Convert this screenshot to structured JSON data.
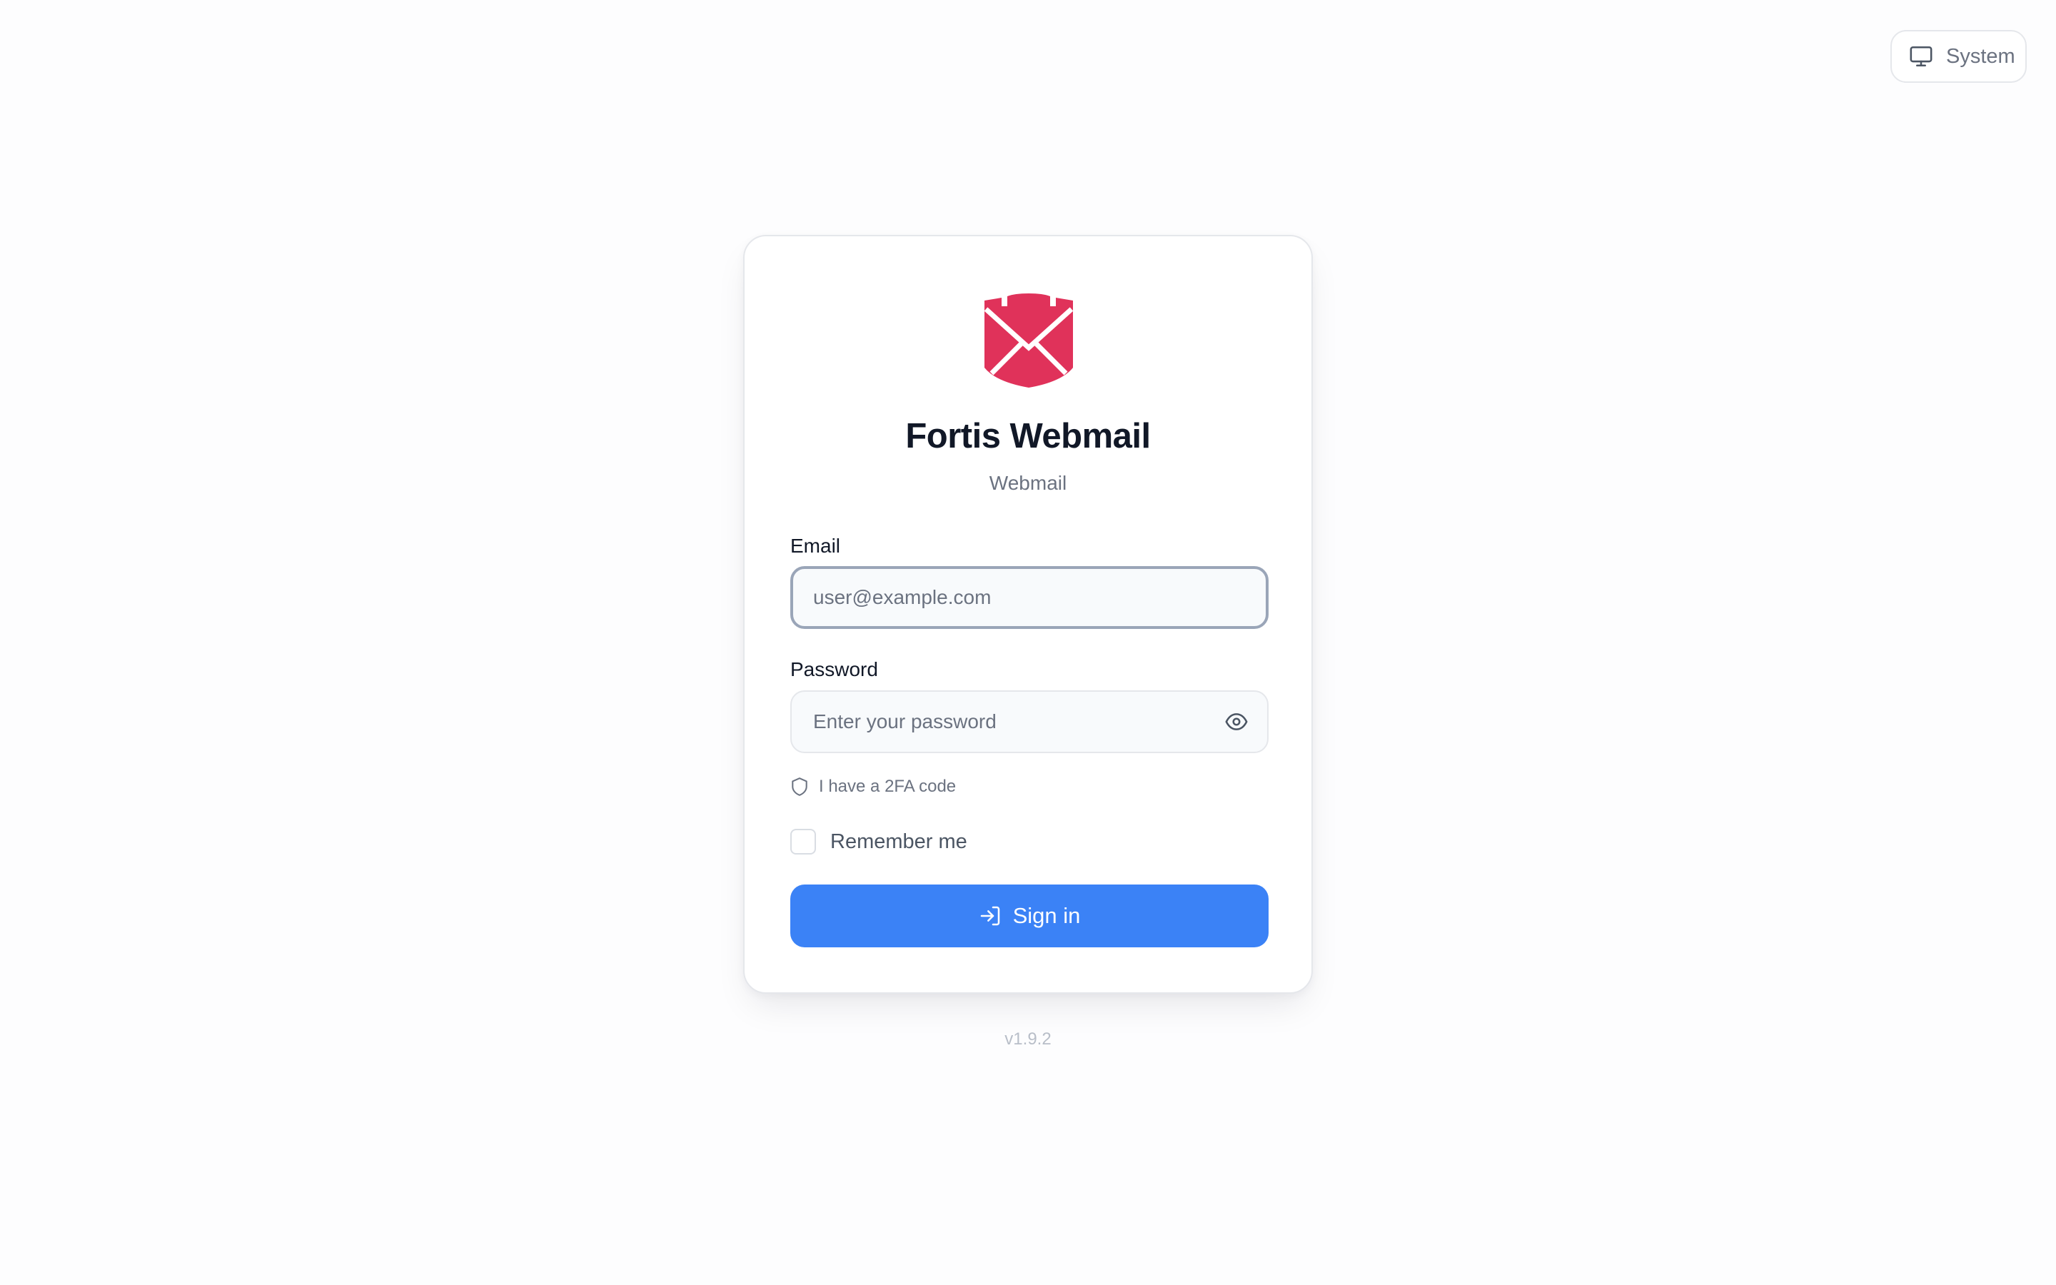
{
  "theme_toggle": {
    "label": "System",
    "icon": "monitor-icon"
  },
  "brand": {
    "title": "Fortis Webmail",
    "subtitle": "Webmail",
    "logo_color": "#e0325a"
  },
  "form": {
    "email": {
      "label": "Email",
      "placeholder": "user@example.com"
    },
    "password": {
      "label": "Password",
      "placeholder": "Enter your password",
      "toggle_icon": "eye-icon"
    },
    "twofa": {
      "label": "I have a 2FA code",
      "icon": "shield-icon"
    },
    "remember": {
      "label": "Remember me",
      "checked": false
    },
    "submit": {
      "label": "Sign in",
      "icon": "log-in-icon",
      "color": "#3b82f6"
    }
  },
  "footer": {
    "version": "v1.9.2"
  }
}
